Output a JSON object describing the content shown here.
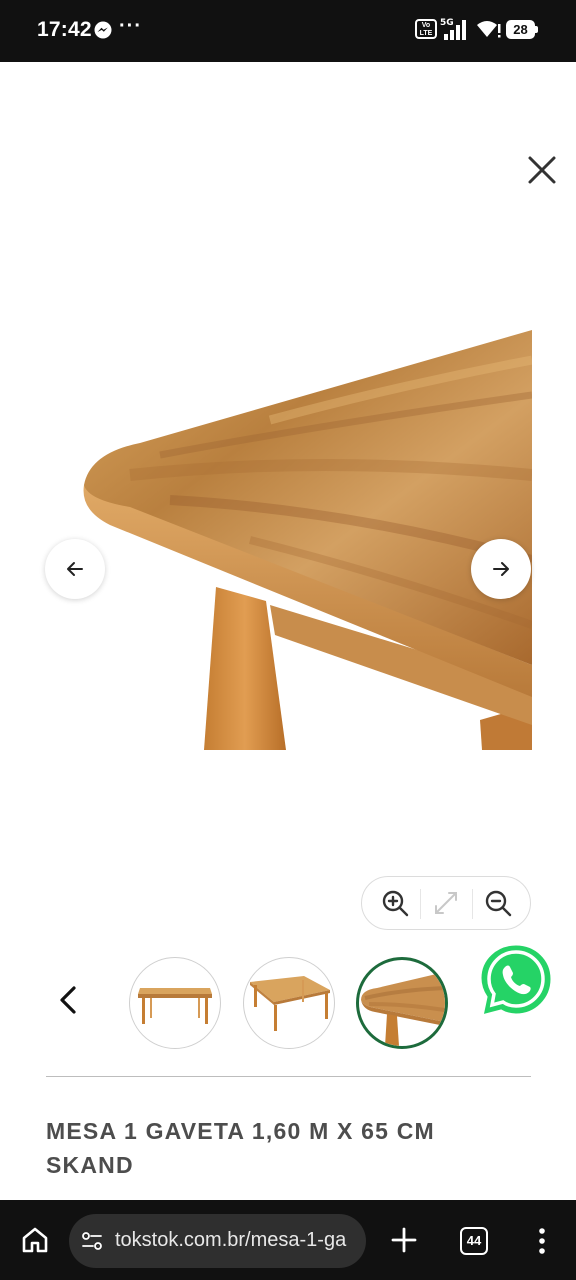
{
  "status_bar": {
    "time": "17:42",
    "more": "···",
    "volte": "Vo LTE",
    "network": "5G",
    "battery": "28"
  },
  "viewer": {
    "icons": [
      "close-icon",
      "arrow-left-icon",
      "arrow-right-icon",
      "zoom-in-icon",
      "fit-screen-icon",
      "zoom-out-icon",
      "chevron-left-icon",
      "whatsapp-icon"
    ],
    "thumbnails": [
      {
        "selected": false
      },
      {
        "selected": false
      },
      {
        "selected": true
      }
    ]
  },
  "product": {
    "title": "MESA 1 GAVETA 1,60 M X 65 CM SKAND"
  },
  "browser": {
    "url": "tokstok.com.br/mesa-1-ga",
    "tab_count": "44"
  },
  "colors": {
    "accent_green": "#1d6b3c",
    "whatsapp_green": "#25d366",
    "title_gray": "#4d4d4d"
  }
}
